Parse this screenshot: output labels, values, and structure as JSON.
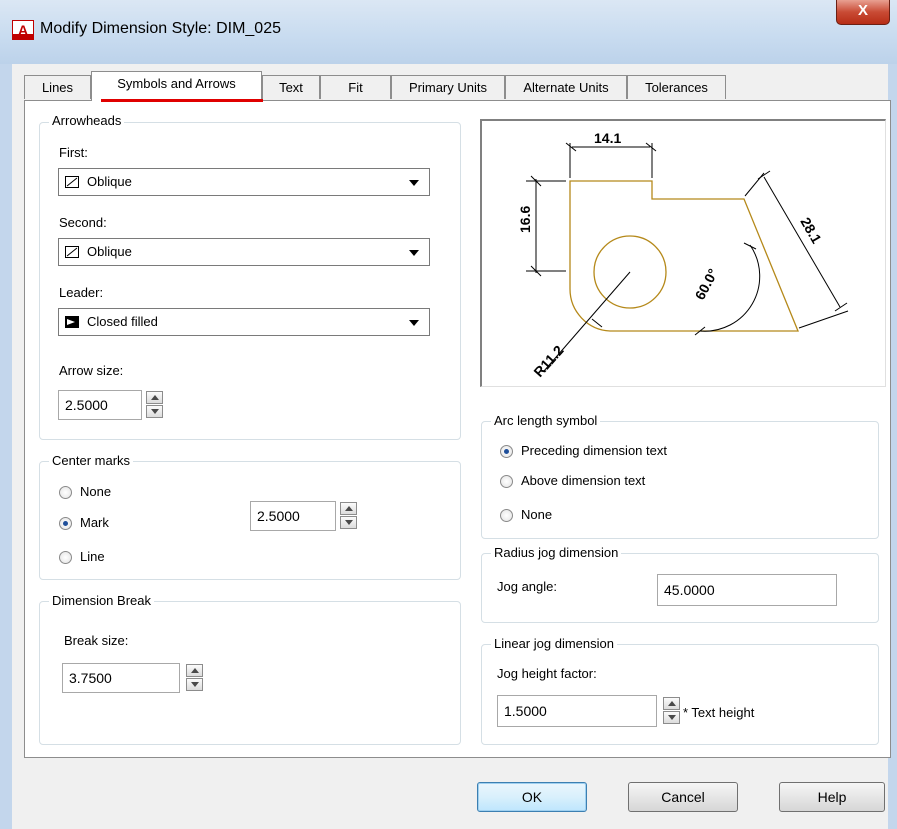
{
  "window": {
    "title": "Modify Dimension Style: DIM_025",
    "icon": "autocad-app-icon",
    "close_label": "X"
  },
  "tabs": [
    {
      "label": "Lines"
    },
    {
      "label": "Symbols and Arrows",
      "active": true
    },
    {
      "label": "Text"
    },
    {
      "label": "Fit"
    },
    {
      "label": "Primary Units"
    },
    {
      "label": "Alternate Units"
    },
    {
      "label": "Tolerances"
    }
  ],
  "arrowheads": {
    "title": "Arrowheads",
    "first": {
      "label": "First:",
      "value": "Oblique",
      "icon": "oblique-arrow-icon"
    },
    "second": {
      "label": "Second:",
      "value": "Oblique",
      "icon": "oblique-arrow-icon"
    },
    "leader": {
      "label": "Leader:",
      "value": "Closed filled",
      "icon": "closed-filled-arrow-icon"
    },
    "arrow_size": {
      "label": "Arrow size:",
      "value": "2.5000"
    }
  },
  "center_marks": {
    "title": "Center marks",
    "options": [
      {
        "label": "None",
        "selected": false
      },
      {
        "label": "Mark",
        "selected": true
      },
      {
        "label": "Line",
        "selected": false
      }
    ],
    "size": "2.5000"
  },
  "dimension_break": {
    "title": "Dimension Break",
    "break_size": {
      "label": "Break size:",
      "value": "3.7500"
    }
  },
  "preview": {
    "dim_top": "14.1",
    "dim_left": "16.6",
    "dim_diag": "28.1",
    "dim_angle": "60.0°",
    "dim_radius": "R11.2",
    "color_lines": "#000000",
    "color_geometry": "#b5891a"
  },
  "arc_length_symbol": {
    "title": "Arc length symbol",
    "options": [
      {
        "label": "Preceding dimension text",
        "selected": true
      },
      {
        "label": "Above dimension text",
        "selected": false
      },
      {
        "label": "None",
        "selected": false
      }
    ]
  },
  "radius_jog": {
    "title": "Radius jog dimension",
    "jog_angle": {
      "label": "Jog angle:",
      "value": "45.0000"
    }
  },
  "linear_jog": {
    "title": "Linear jog dimension",
    "jog_height": {
      "label": "Jog height factor:",
      "value": "1.5000",
      "suffix": "* Text height"
    }
  },
  "buttons": {
    "ok": "OK",
    "cancel": "Cancel",
    "help": "Help"
  },
  "colors": {
    "tab_highlight": "#e00000",
    "close_button": "#c94b35",
    "radio_selected": "#1f4f9a"
  }
}
